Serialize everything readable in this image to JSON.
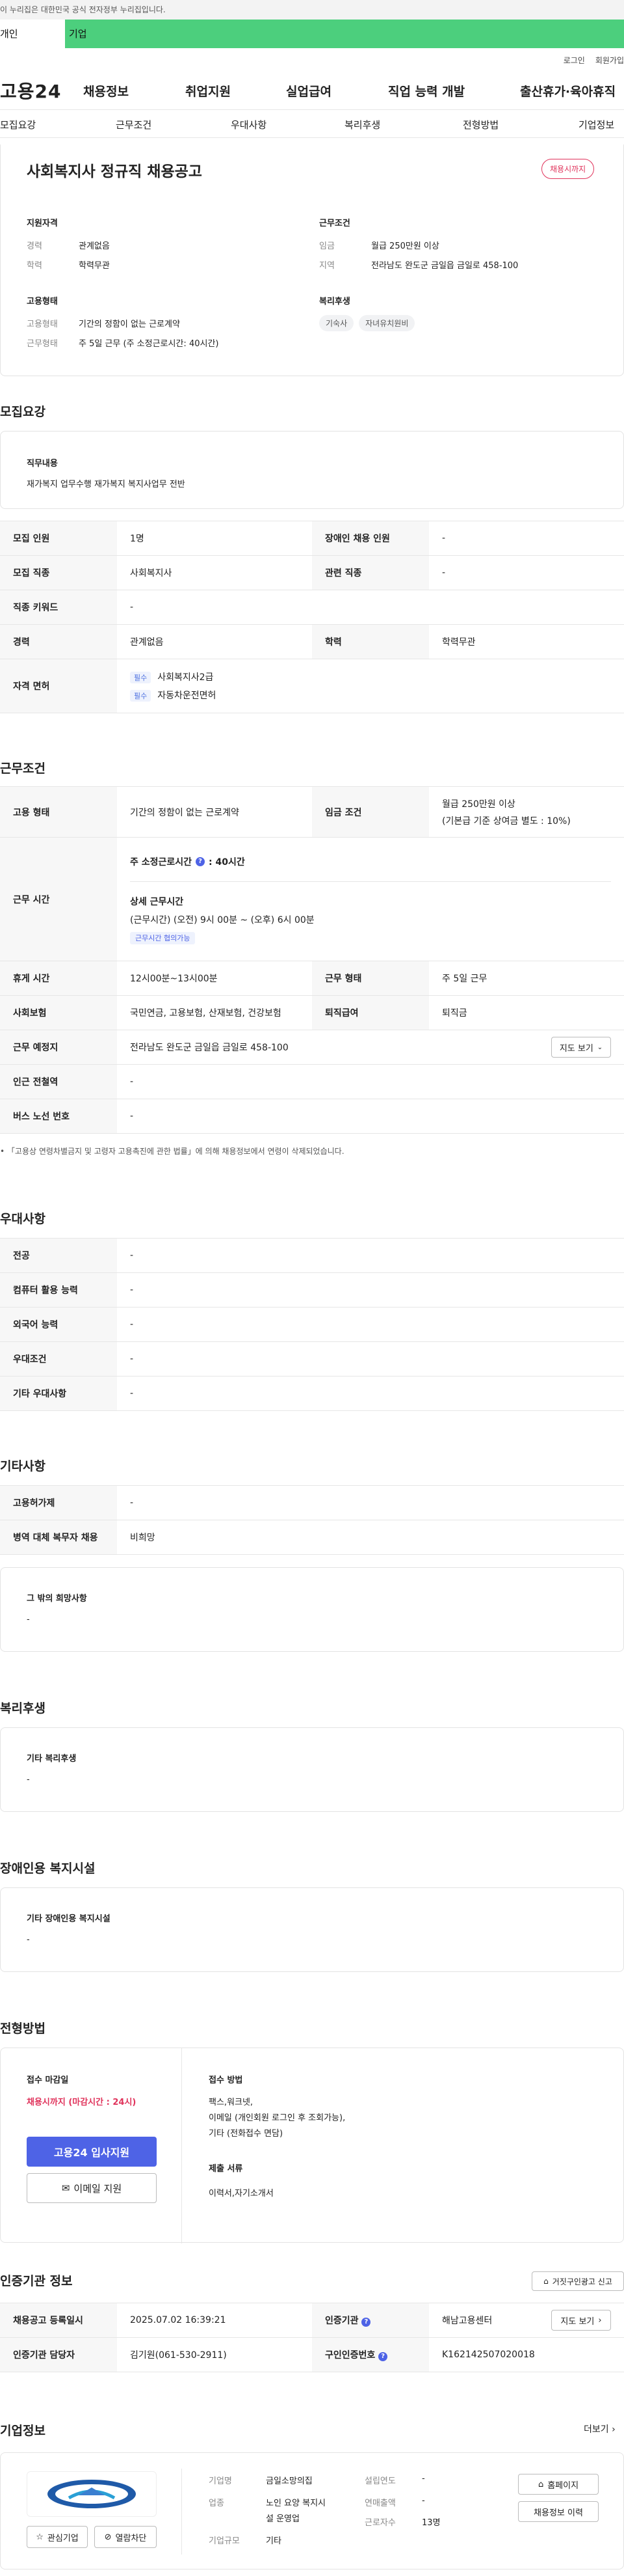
{
  "gov_notice": "이 누리집은 대한민국 공식 전자정부 누리집입니다.",
  "top_tabs": [
    "개인",
    "기업"
  ],
  "util_links": [
    "로그인",
    "회원가입"
  ],
  "logo": "고용24",
  "gnb": [
    "채용정보",
    "취업지원",
    "실업급여",
    "직업 능력 개발",
    "출산휴가·육아휴직"
  ],
  "subnav": [
    "모집요강",
    "근무조건",
    "우대사항",
    "복리후생",
    "전형방법",
    "기업정보"
  ],
  "job": {
    "title": "사회복지사 정규직 채용공고",
    "status": "채용시까지",
    "qual_head": "지원자격",
    "qual": [
      {
        "k": "경력",
        "v": "관계없음"
      },
      {
        "k": "학력",
        "v": "학력무관"
      }
    ],
    "cond_head": "근무조건",
    "cond": [
      {
        "k": "임금",
        "v": "월급 250만원 이상"
      },
      {
        "k": "지역",
        "v": "전라남도 완도군 금일읍 금일로 458-100"
      }
    ],
    "emp_head": "고용형태",
    "emp": [
      {
        "k": "고용형태",
        "v": "기간의 정함이 없는 근로계약"
      },
      {
        "k": "근무형태",
        "v": "주 5일 근무 (주 소정근로시간: 40시간)"
      }
    ],
    "welfare_head": "복리후생",
    "welfare": [
      "기숙사",
      "자녀유치원비"
    ]
  },
  "recruit": {
    "heading": "모집요강",
    "duty_head": "직무내용",
    "duty": "재가복지 업무수행  재가복지 복지사업무 전반",
    "rows": {
      "count_k": "모집 인원",
      "count_v": "1명",
      "disabled_k": "장애인 채용 인원",
      "disabled_v": "-",
      "job_k": "모집 직종",
      "job_v": "사회복지사",
      "related_k": "관련 직종",
      "related_v": "-",
      "keyword_k": "직종 키워드",
      "keyword_v": "-",
      "career_k": "경력",
      "career_v": "관계없음",
      "edu_k": "학력",
      "edu_v": "학력무관",
      "license_k": "자격 면허",
      "req_label": "필수",
      "license1": "사회복지사2급",
      "license2": "자동차운전면허"
    }
  },
  "work": {
    "heading": "근무조건",
    "type_k": "고용 형태",
    "type_v": "기간의 정함이 없는 근로계약",
    "wage_k": "임금 조건",
    "wage_v1": "월급 250만원 이상",
    "wage_v2": "(기본급 기준 상여금 별도 : 10%)",
    "hours_k": "근무 시간",
    "hours_main": "주 소정근로시간",
    "hours_main_v": ": 40시간",
    "hours_detail_head": "상세 근무시간",
    "hours_detail": "(근무시간) (오전) 9시 00분 ~ (오후) 6시 00분",
    "hours_tag": "근무시간 협의가능",
    "break_k": "휴게 시간",
    "break_v": "12시00분~13시00분",
    "shift_k": "근무 형태",
    "shift_v": "주 5일 근무",
    "ins_k": "사회보험",
    "ins_v": "국민연금, 고용보험, 산재보험, 건강보험",
    "retire_k": "퇴직급여",
    "retire_v": "퇴직금",
    "place_k": "근무 예정지",
    "place_v": "전라남도 완도군 금일읍 금일로 458-100",
    "map_btn": "지도 보기",
    "subway_k": "인근 전철역",
    "subway_v": "-",
    "bus_k": "버스 노선 번호",
    "bus_v": "-",
    "footnote": "「고용상 연령차별금지 및 고령자 고용촉진에 관한 법률」에 의해 채용정보에서 연령이 삭제되었습니다."
  },
  "prefer": {
    "heading": "우대사항",
    "rows": [
      {
        "k": "전공",
        "v": "-"
      },
      {
        "k": "컴퓨터 활용 능력",
        "v": "-"
      },
      {
        "k": "외국어 능력",
        "v": "-"
      },
      {
        "k": "우대조건",
        "v": "-"
      },
      {
        "k": "기타 우대사항",
        "v": "-"
      }
    ]
  },
  "etc": {
    "heading": "기타사항",
    "rows": [
      {
        "k": "고용허가제",
        "v": "-"
      },
      {
        "k": "병역 대체 복무자 채용",
        "v": "비희망"
      }
    ],
    "wish_head": "그 밖의 희망사항",
    "wish_v": "-"
  },
  "welfare": {
    "heading": "복리후생",
    "box_head": "기타 복리후생",
    "box_v": "-"
  },
  "disabled_fac": {
    "heading": "장애인용 복지시설",
    "box_head": "기타 장애인용 복지시설",
    "box_v": "-"
  },
  "apply": {
    "heading": "전형방법",
    "deadline_head": "접수 마감일",
    "deadline_v": "채용시까지 (마감시간 : 24시)",
    "apply_btn": "고용24 입사지원",
    "email_btn": "이메일 지원",
    "method_head": "접수 방법",
    "method_v1": "팩스,워크넷,",
    "method_v2": "이메일 (개인회원 로그인 후 조회가능),",
    "method_v3": "기타 (전화접수 면담)",
    "docs_head": "제출 서류",
    "docs_v": "이력서,자기소개서"
  },
  "agency": {
    "heading": "인증기관 정보",
    "report_btn": "거짓구인광고 신고",
    "reg_k": "채용공고 등록일시",
    "reg_v": "2025.07.02 16:39:21",
    "org_k": "인증기관",
    "org_v": "해남고용센터",
    "map_btn": "지도 보기",
    "mgr_k": "인증기관 담당자",
    "mgr_v": "김기원(061-530-2911)",
    "cert_k": "구인인증번호",
    "cert_v": "K162142507020018"
  },
  "company": {
    "heading": "기업정보",
    "more": "더보기",
    "fav_btn": "관심기업",
    "block_btn": "열람차단",
    "name_k": "기업명",
    "name_v": "금일소망의집",
    "biz_k": "업종",
    "biz_v1": "노인 요양 복지시",
    "biz_v2": "설 운영업",
    "size_k": "기업규모",
    "size_v": "기타",
    "founded_k": "설립연도",
    "founded_v": "-",
    "sales_k": "연매출액",
    "sales_v": "-",
    "staff_k": "근로자수",
    "staff_v": "13명",
    "home_btn": "홈페이지",
    "history_btn": "채용정보 이력"
  },
  "colors": {
    "green": "#4ccf7d",
    "primary": "#4e63e6",
    "danger": "#e0335b"
  }
}
